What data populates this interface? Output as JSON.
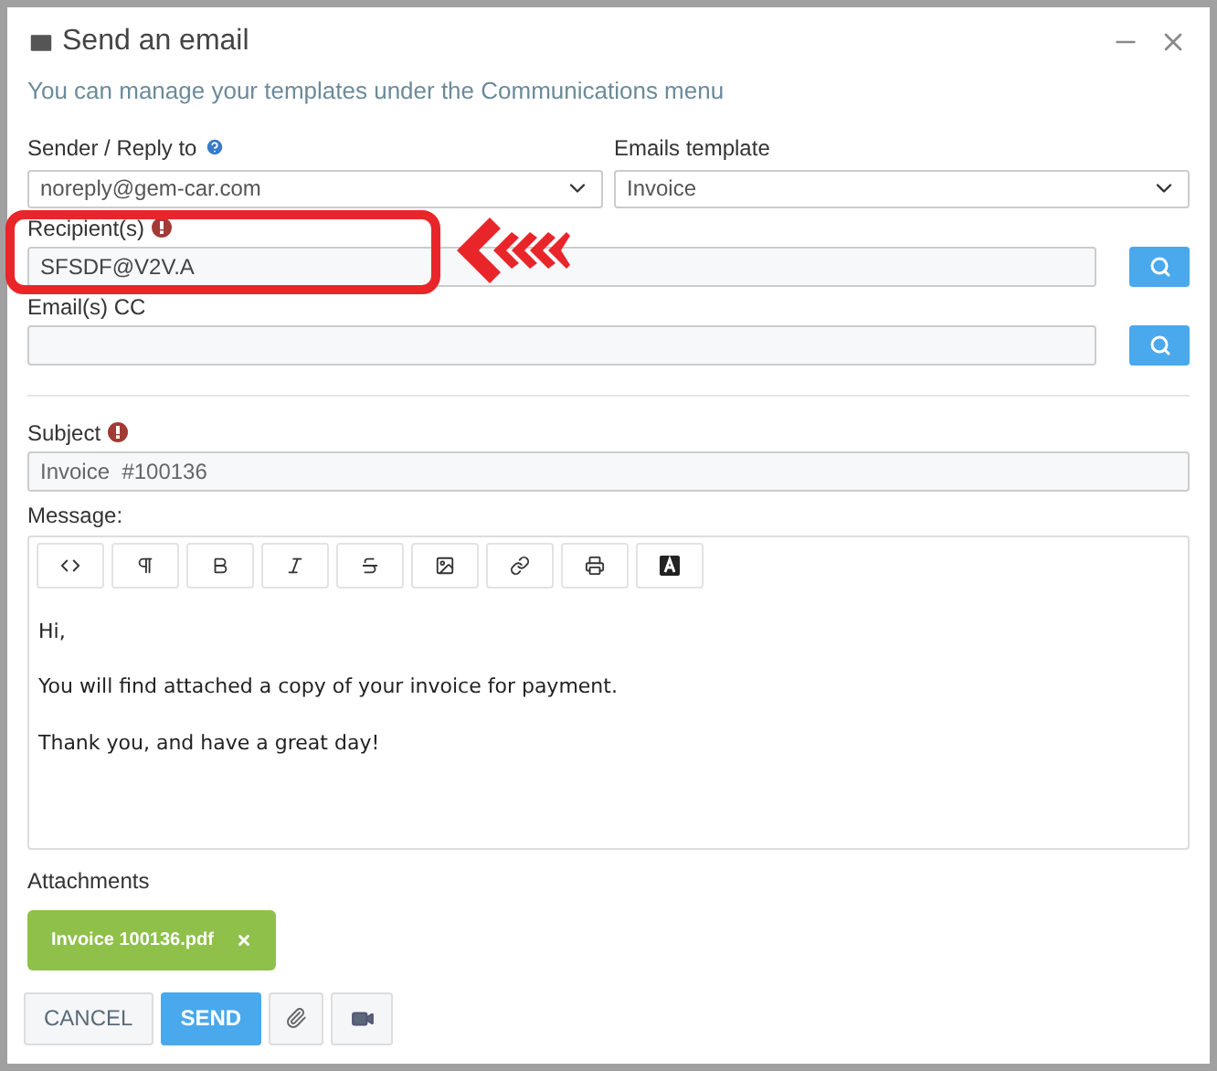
{
  "window": {
    "title": "Send an email"
  },
  "hint": "You can manage your templates under the Communications menu",
  "sender": {
    "label": "Sender / Reply to",
    "value": "noreply@gem-car.com"
  },
  "template": {
    "label": "Emails template",
    "value": "Invoice"
  },
  "recipients": {
    "label": "Recipient(s)",
    "value": "SFSDF@V2V.A",
    "required": true
  },
  "cc": {
    "label": "Email(s) CC",
    "required": false
  },
  "subject": {
    "label": "Subject",
    "value": "Invoice  #100136",
    "required": true
  },
  "message": {
    "label": "Message:",
    "toolbar": [
      {
        "kind": "code"
      },
      {
        "kind": "paragraph"
      },
      {
        "kind": "bold"
      },
      {
        "kind": "italic"
      },
      {
        "kind": "strike"
      },
      {
        "kind": "image"
      },
      {
        "kind": "link"
      },
      {
        "kind": "print"
      },
      {
        "kind": "font"
      }
    ],
    "paragraphs": [
      "Hi,",
      "You will find attached a copy of your invoice for payment.",
      "Thank you, and have a great day!"
    ]
  },
  "attachments": {
    "label": "Attachments",
    "files": [
      "Invoice 100136.pdf"
    ]
  },
  "buttons": {
    "cancel": "CANCEL",
    "send": "SEND"
  },
  "annotation": {
    "shown": true
  }
}
